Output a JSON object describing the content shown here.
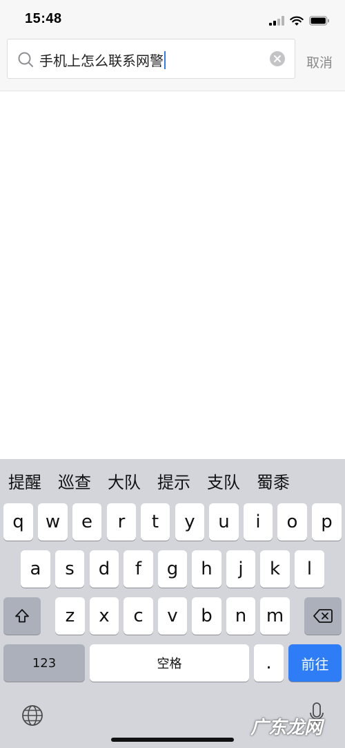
{
  "status": {
    "time": "15:48"
  },
  "search": {
    "query": "手机上怎么联系网警",
    "cancel_label": "取消"
  },
  "keyboard": {
    "candidates": [
      "提醒",
      "巡查",
      "大队",
      "提示",
      "支队",
      "蜀黍"
    ],
    "row1": [
      "q",
      "w",
      "e",
      "r",
      "t",
      "y",
      "u",
      "i",
      "o",
      "p"
    ],
    "row2": [
      "a",
      "s",
      "d",
      "f",
      "g",
      "h",
      "j",
      "k",
      "l"
    ],
    "row3": [
      "z",
      "x",
      "c",
      "v",
      "b",
      "n",
      "m"
    ],
    "numbers_label": "123",
    "space_label": "空格",
    "period_label": ".",
    "go_label": "前往",
    "colors": {
      "go": "#2e7cf6",
      "background": "#d3d5db"
    }
  },
  "watermark": {
    "text": "广东龙网"
  }
}
